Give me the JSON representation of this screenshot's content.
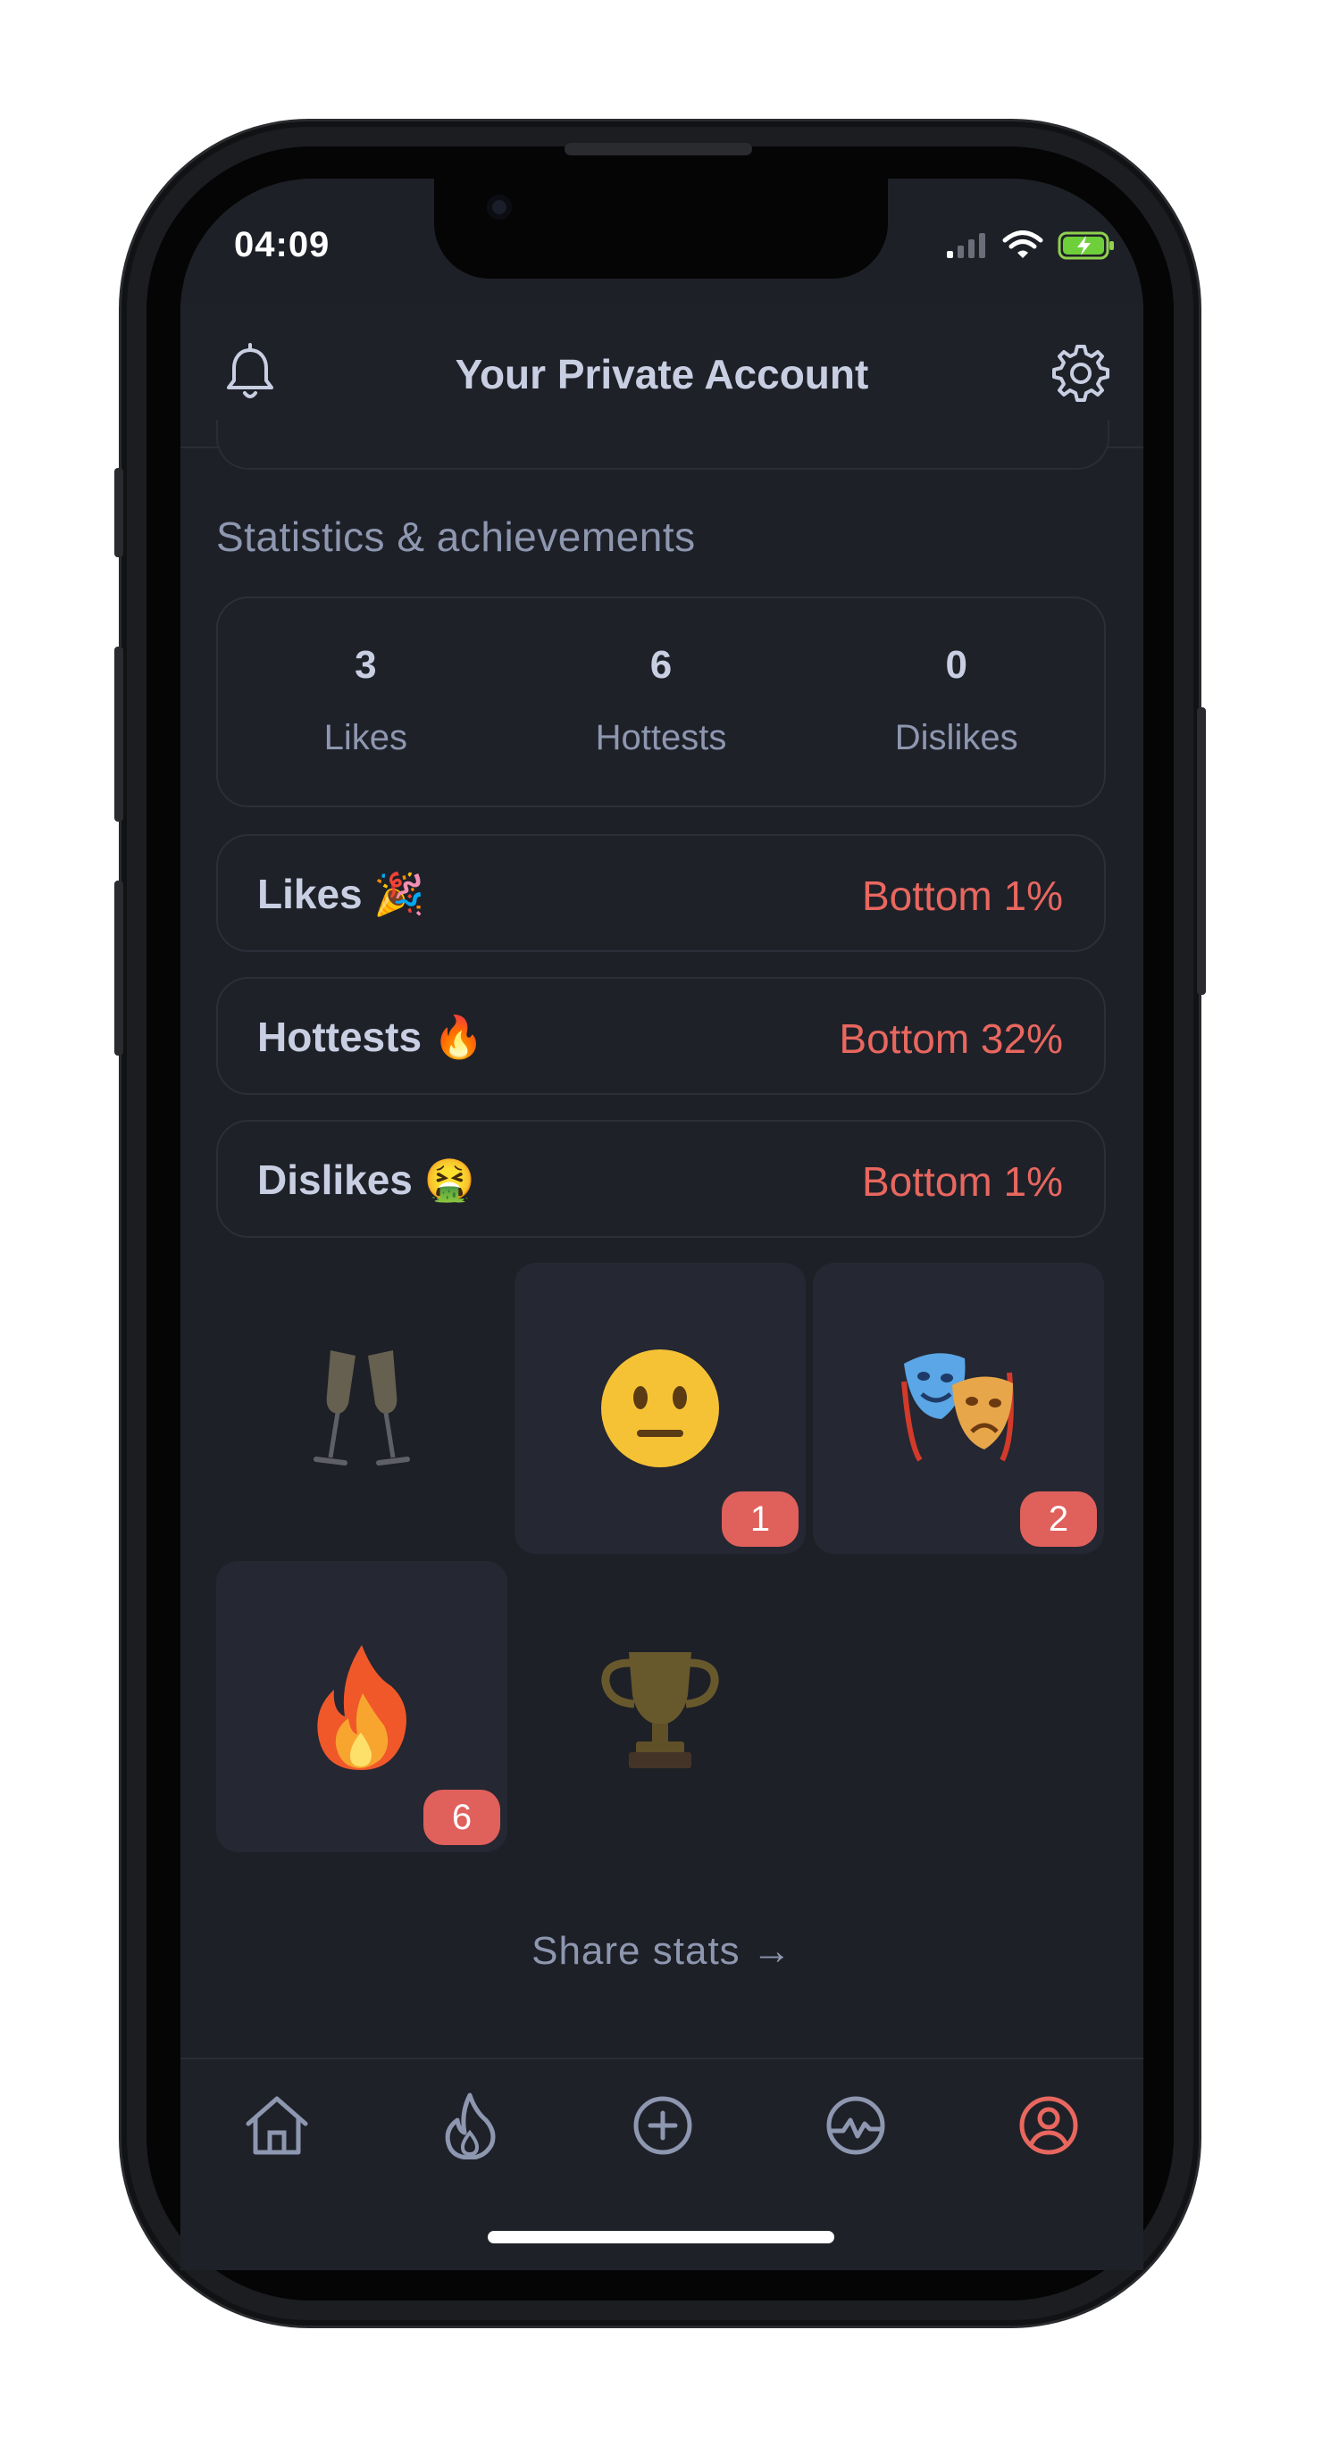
{
  "status_bar": {
    "time": "04:09"
  },
  "header": {
    "title": "Your Private Account"
  },
  "section_title": "Statistics & achievements",
  "stats": [
    {
      "value": "3",
      "label": "Likes"
    },
    {
      "value": "6",
      "label": "Hottests"
    },
    {
      "value": "0",
      "label": "Dislikes"
    }
  ],
  "rankings": [
    {
      "label": "Likes 🎉",
      "value": "Bottom 1%"
    },
    {
      "label": "Hottests 🔥",
      "value": "Bottom 32%"
    },
    {
      "label": "Dislikes 🤮",
      "value": "Bottom 1%"
    }
  ],
  "achievements": [
    {
      "icon": "champagne-icon",
      "glyph": "🥂",
      "locked": true,
      "count": ""
    },
    {
      "icon": "neutral-face-icon",
      "glyph": "😐",
      "locked": false,
      "count": "1"
    },
    {
      "icon": "theater-masks-icon",
      "glyph": "🎭",
      "locked": false,
      "count": "2"
    },
    {
      "icon": "fire-icon",
      "glyph": "🔥",
      "locked": false,
      "count": "6"
    },
    {
      "icon": "trophy-icon",
      "glyph": "🏆",
      "locked": true,
      "count": ""
    }
  ],
  "share_label": "Share stats →",
  "tabs": [
    {
      "name": "home",
      "icon": "home-icon",
      "active": false
    },
    {
      "name": "hot",
      "icon": "flame-icon",
      "active": false
    },
    {
      "name": "add",
      "icon": "plus-circle-icon",
      "active": false
    },
    {
      "name": "activity",
      "icon": "activity-icon",
      "active": false
    },
    {
      "name": "profile",
      "icon": "user-circle-icon",
      "active": true
    }
  ],
  "colors": {
    "background": "#1e2027",
    "card": "#1f2129",
    "text_primary": "#c9cfe2",
    "text_secondary": "#8e97b0",
    "accent_red": "#e8675f",
    "badge": "#e0605b"
  }
}
